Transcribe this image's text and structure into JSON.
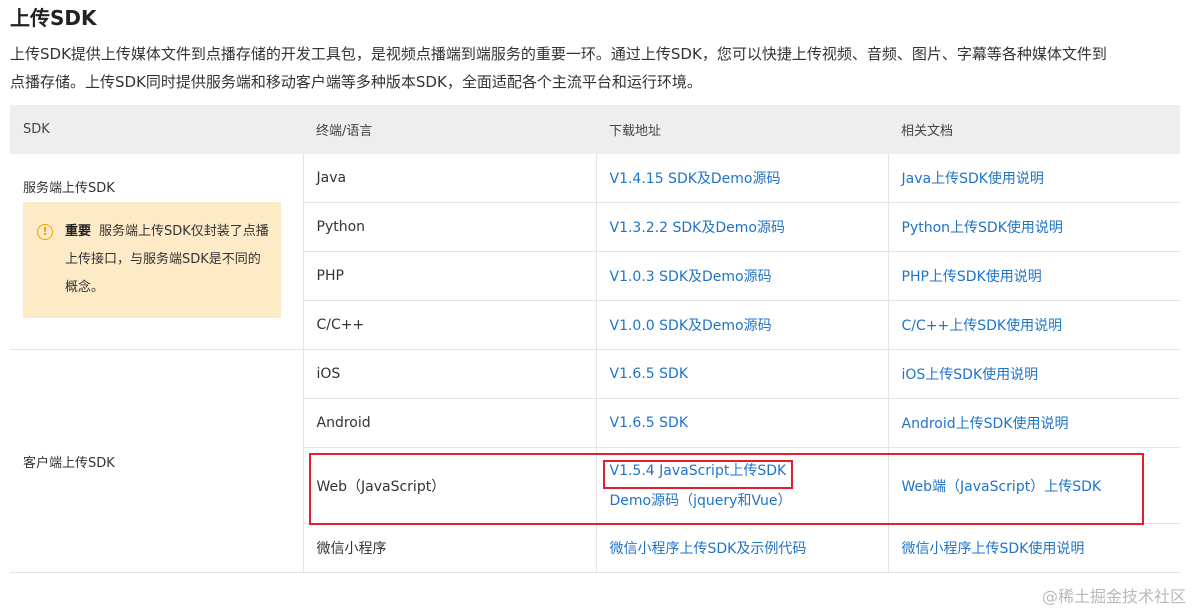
{
  "title": "上传SDK",
  "intro": {
    "line1": "上传SDK提供上传媒体文件到点播存储的开发工具包，是视频点播端到端服务的重要一环。通过上传SDK，您可以快捷上传视频、音频、图片、字幕等各种媒体文件到",
    "line2": "点播存储。上传SDK同时提供服务端和移动客户端等多种版本SDK，全面适配各个主流平台和运行环境。"
  },
  "table": {
    "headers": [
      "SDK",
      "终端/语言",
      "下载地址",
      "相关文档"
    ],
    "server_group": {
      "label": "服务端上传SDK",
      "notice": {
        "icon": "info-icon",
        "icon_glyph": "!",
        "strong": "重要",
        "text": "服务端上传SDK仅封装了点播上传接口，与服务端SDK是不同的概念。"
      },
      "rows": [
        {
          "lang": "Java",
          "download": "V1.4.15 SDK及Demo源码",
          "doc": "Java上传SDK使用说明"
        },
        {
          "lang": "Python",
          "download": "V1.3.2.2 SDK及Demo源码",
          "doc": "Python上传SDK使用说明"
        },
        {
          "lang": "PHP",
          "download": "V1.0.3 SDK及Demo源码",
          "doc": "PHP上传SDK使用说明"
        },
        {
          "lang": "C/C++",
          "download": "V1.0.0 SDK及Demo源码",
          "doc": "C/C++上传SDK使用说明"
        }
      ]
    },
    "client_group": {
      "label": "客户端上传SDK",
      "rows": [
        {
          "lang": "iOS",
          "download": "V1.6.5 SDK",
          "doc": "iOS上传SDK使用说明"
        },
        {
          "lang": "Android",
          "download": "V1.6.5 SDK",
          "doc": "Android上传SDK使用说明"
        },
        {
          "lang": "Web（JavaScript）",
          "download": "V1.5.4 JavaScript上传SDK",
          "download2": "Demo源码（jquery和Vue）",
          "doc": "Web端（JavaScript）上传SDK"
        },
        {
          "lang": "微信小程序",
          "download": "微信小程序上传SDK及示例代码",
          "doc": "微信小程序上传SDK使用说明"
        }
      ]
    }
  },
  "highlight_color": "#e2202c",
  "link_color": "#1e74c9",
  "watermark": "@稀土掘金技术社区"
}
